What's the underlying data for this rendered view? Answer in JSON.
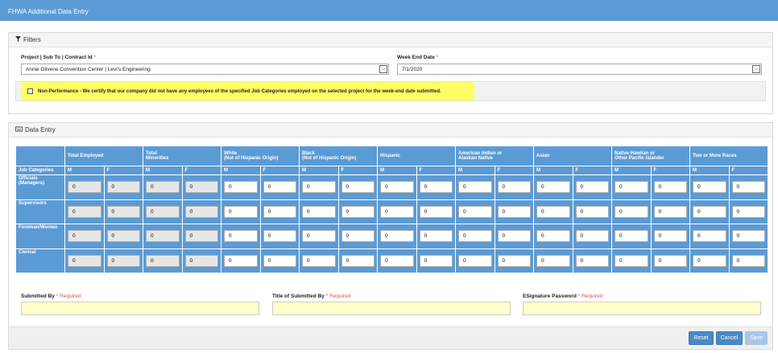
{
  "window": {
    "title": "FHWA Additional Data Entry"
  },
  "filters": {
    "heading": "Filters",
    "project_label": "Project | Sub To | Contract Id",
    "project_value": "Annie Olivene Convention Center | Levi's Engineering",
    "week_label": "Week End Date",
    "week_value": "7/1/2020",
    "required_mark": "*",
    "nonperformance_text": "Non-Performance - We certify that our company did not have any employees of the specified Job Categories employed on the selected project for the week-end date submitted."
  },
  "data_entry": {
    "heading": "Data Entry",
    "job_categories_label": "Job Categories",
    "groups": [
      {
        "name": "Total Employed",
        "readonly": true
      },
      {
        "name": "Total\nMinorities",
        "readonly": true
      },
      {
        "name": "White\n(Not of Hispanic Origin)",
        "readonly": false
      },
      {
        "name": "Black\n(Not of Hispanic Origin)",
        "readonly": false
      },
      {
        "name": "Hispanic",
        "readonly": false
      },
      {
        "name": "American Indian or\nAlaskan Native",
        "readonly": false
      },
      {
        "name": "Asian",
        "readonly": false
      },
      {
        "name": "Native Hawiian or\nOther Pacific Islander",
        "readonly": false
      },
      {
        "name": "Two or More Races",
        "readonly": false
      }
    ],
    "sub_m": "M",
    "sub_f": "F",
    "rows": [
      {
        "label": "Officials\n(Managers)",
        "values": [
          "0",
          "0",
          "0",
          "0",
          "0",
          "0",
          "0",
          "0",
          "0",
          "0",
          "0",
          "0",
          "0",
          "0",
          "0",
          "0",
          "0",
          "0"
        ]
      },
      {
        "label": "Supervisors",
        "values": [
          "0",
          "0",
          "0",
          "0",
          "0",
          "0",
          "0",
          "0",
          "0",
          "0",
          "0",
          "0",
          "0",
          "0",
          "0",
          "0",
          "0",
          "0"
        ]
      },
      {
        "label": "Foreman/Women",
        "values": [
          "0",
          "0",
          "0",
          "0",
          "0",
          "0",
          "0",
          "0",
          "0",
          "0",
          "0",
          "0",
          "0",
          "0",
          "0",
          "0",
          "0",
          "0"
        ]
      },
      {
        "label": "Clerical",
        "values": [
          "0",
          "0",
          "0",
          "0",
          "0",
          "0",
          "0",
          "0",
          "0",
          "0",
          "0",
          "0",
          "0",
          "0",
          "0",
          "0",
          "0",
          "0"
        ]
      }
    ],
    "submitted_by_label": "Submitted By",
    "title_label": "Title of Submitted By",
    "esig_label": "ESignature Password",
    "required_text": "* Required"
  },
  "buttons": {
    "reset": "Reset",
    "cancel": "Cancel",
    "save": "Save"
  },
  "colors": {
    "header_blue": "#5b9bd5",
    "highlight": "#ffff66",
    "signature_fill": "#ffffcc"
  }
}
